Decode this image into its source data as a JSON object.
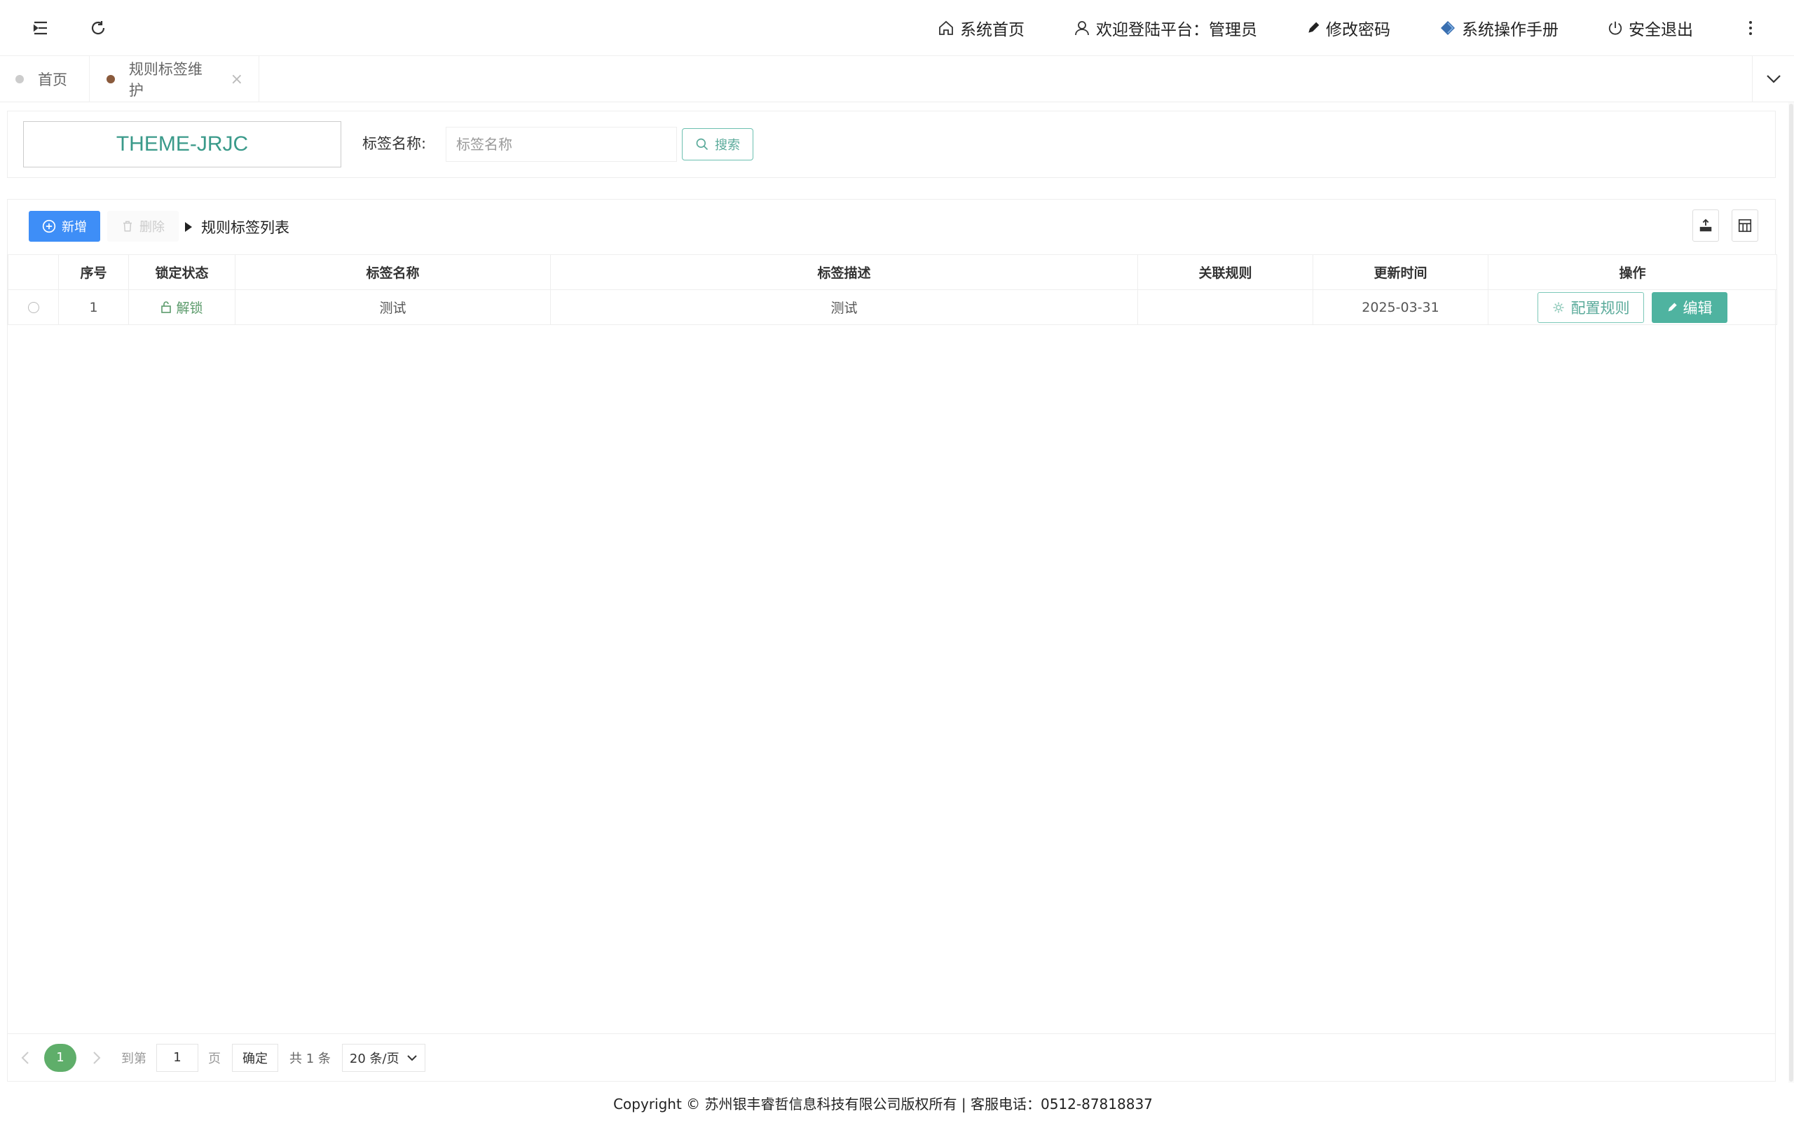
{
  "header": {
    "nav": [
      {
        "name": "system-home",
        "label": "系统首页"
      },
      {
        "name": "welcome",
        "label": "欢迎登陆平台：管理员"
      },
      {
        "name": "change-password",
        "label": "修改密码"
      },
      {
        "name": "manual",
        "label": "系统操作手册"
      },
      {
        "name": "logout",
        "label": "安全退出"
      }
    ]
  },
  "tabs": {
    "home": "首页",
    "active": "规则标签维护",
    "close": "×"
  },
  "search": {
    "theme": "THEME-JRJC",
    "label": "标签名称:",
    "placeholder": "标签名称",
    "button": "搜索"
  },
  "toolbar": {
    "add": "新增",
    "delete": "删除",
    "list_title": "规则标签列表"
  },
  "table": {
    "columns": [
      "",
      "序号",
      "锁定状态",
      "标签名称",
      "标签描述",
      "关联规则",
      "更新时间",
      "操作"
    ],
    "rows": [
      {
        "index": "1",
        "lock": "解锁",
        "name": "测试",
        "desc": "测试",
        "rules": "",
        "updated": "2025-03-31",
        "config_btn": "配置规则",
        "edit_btn": "编辑"
      }
    ]
  },
  "pager": {
    "current": "1",
    "goto_label": "到第",
    "page_value": "1",
    "page_unit": "页",
    "confirm": "确定",
    "total": "共 1 条",
    "page_size": "20 条/页"
  },
  "footer": "Copyright © 苏州银丰睿哲信息科技有限公司版权所有 | 客服电话：0512-87818837",
  "colors": {
    "primary_blue": "#3e8ef7",
    "teal": "#4fb3a0",
    "pager_green": "#5fae6a"
  }
}
